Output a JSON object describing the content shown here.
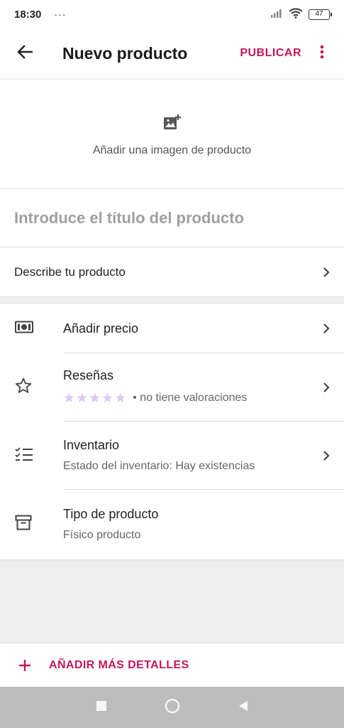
{
  "status_bar": {
    "time": "18:30",
    "dots": "···",
    "battery": "47"
  },
  "header": {
    "back_icon": "arrow-back-icon",
    "title": "Nuevo producto",
    "publish_label": "PUBLICAR",
    "more_icon": "more-vert-icon"
  },
  "image_section": {
    "icon": "add-photo-icon",
    "label": "Añadir una imagen de producto"
  },
  "title_field": {
    "placeholder": "Introduce el título del producto",
    "value": ""
  },
  "describe": {
    "label": "Describe tu producto"
  },
  "rows": [
    {
      "icon": "money-icon",
      "title": "Añadir precio"
    },
    {
      "icon": "star-icon",
      "title": "Reseñas",
      "rating": 0,
      "stars": "★★★★★",
      "subtitle": "• no tiene valoraciones"
    },
    {
      "icon": "checklist-icon",
      "title": "Inventario",
      "subtitle": "Estado del inventario: Hay existencias"
    },
    {
      "icon": "archive-box-icon",
      "title": "Tipo de producto",
      "subtitle": "Físico producto"
    }
  ],
  "footer": {
    "add_details_label": "AÑADIR MÁS DETALLES",
    "plus_icon": "plus-icon"
  },
  "colors": {
    "accent": "#c2185b",
    "star_empty": "#d9c8f0",
    "divider": "#e0e0e0",
    "band": "#eeeeee",
    "nav_bar": "#bdbdbd"
  }
}
